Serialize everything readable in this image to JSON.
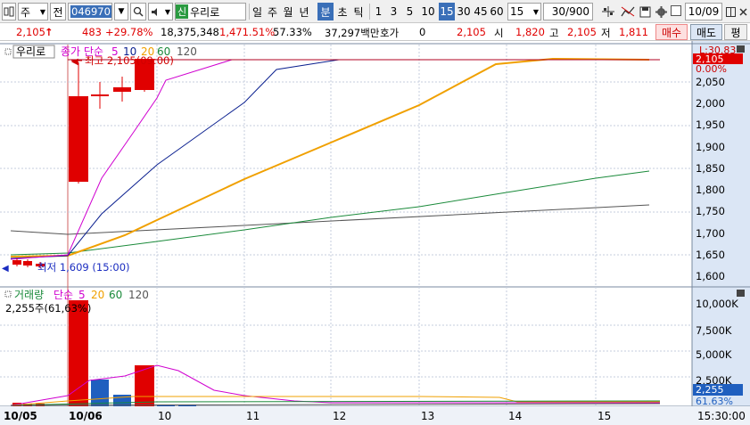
{
  "toolbar": {
    "market_type": "주",
    "market_label": "전",
    "code_value": "046970",
    "stock_name": "우리로",
    "new_badge": "신",
    "periods": [
      "일",
      "주",
      "월",
      "년",
      "분",
      "초",
      "틱"
    ],
    "intervals": [
      "1",
      "3",
      "5",
      "10",
      "15",
      "30",
      "45",
      "60"
    ],
    "active_period": "분",
    "active_interval": "15",
    "custom_interval": "15",
    "count_value": "30/900",
    "date_value": "10/09"
  },
  "quote": {
    "price": "2,105",
    "arrow": "↑",
    "change": "483",
    "change_pct": "+29.78%",
    "volume": "18,375,348",
    "volume_ratio": "1,471.51%",
    "turnover": "57.33%",
    "amount": "37,297백만",
    "hoga_label": "호가",
    "hoga_value": "0",
    "hoga_price": "2,105",
    "open_label": "시",
    "open": "1,820",
    "high_label": "고",
    "high": "2,105",
    "low_label": "저",
    "low": "1,811",
    "buy_label": "매수",
    "sell_label": "매도",
    "eval_label": "평"
  },
  "price_panel": {
    "stock_tag": "우리로",
    "ma_title": "종가 단순",
    "ma_periods": [
      "5",
      "10",
      "20",
      "60",
      "120"
    ],
    "high_marker": "최고 2,105(09:00)",
    "low_marker": "최저 1,609 (15:00)",
    "limit_label": "L:30.83",
    "current_price_tag": "2,105",
    "pct_label": "0.00%",
    "y_ticks": [
      "2,050",
      "2,000",
      "1,950",
      "1,900",
      "1,850",
      "1,800",
      "1,750",
      "1,700",
      "1,650",
      "1,600"
    ]
  },
  "volume_panel": {
    "title": "거래량",
    "ma_title": "단순",
    "ma_periods": [
      "5",
      "20",
      "60",
      "120"
    ],
    "current_volume": "2,255주(61,63%)",
    "y_ticks": [
      "10,000K",
      "7,500K",
      "5,000K",
      "2,500K"
    ],
    "current_tag": "2,255",
    "pct_label": "61.63%"
  },
  "x_axis": {
    "labels": [
      "10/05",
      "10/06",
      "10",
      "11",
      "12",
      "13",
      "14",
      "15"
    ],
    "time_label": "15:30:00"
  },
  "colors": {
    "up": "#e00000",
    "down": "#1f5fbf",
    "ma5": "#d000d0",
    "ma10": "#0a1f8f",
    "ma20": "#f0a000",
    "ma60": "#1a8a3a",
    "ma120": "#555555",
    "axis_bg": "#dbe6f5",
    "toolbar_active": "#3a6fb8"
  },
  "icons": [
    "chart-type-icon",
    "search-icon",
    "speaker-icon",
    "arrow-down-icon",
    "crosshair-icon",
    "trend-icon",
    "save-icon",
    "gear-icon",
    "tile-icon",
    "close-icon"
  ]
}
